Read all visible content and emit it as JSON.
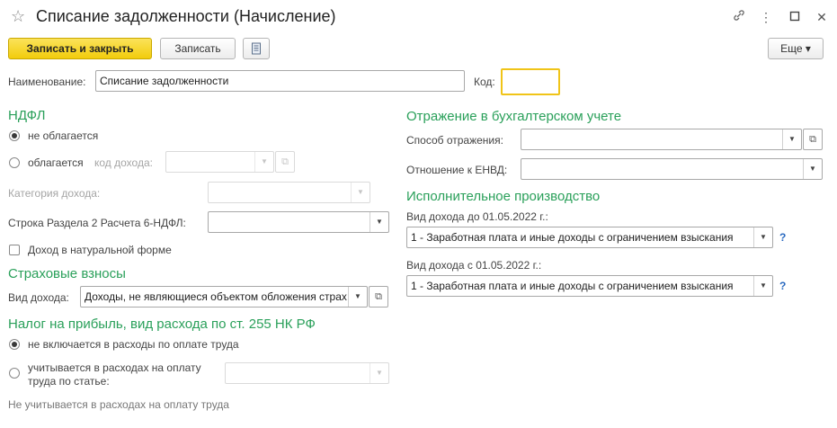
{
  "header": {
    "title": "Списание задолженности (Начисление)",
    "star": "☆",
    "link_icon": "🔗",
    "more_icon": "⋮",
    "maximize_icon": "☐",
    "close_icon": "✕"
  },
  "toolbar": {
    "save_close_label": "Записать и закрыть",
    "save_label": "Записать",
    "more_label": "Еще ▾"
  },
  "name_row": {
    "name_label": "Наименование:",
    "name_value": "Списание задолженности",
    "code_label": "Код:",
    "code_value": ""
  },
  "ndfl": {
    "heading": "НДФЛ",
    "option_not_taxed": "не облагается",
    "option_taxed": "облагается",
    "income_code_label": "код дохода:",
    "income_category_label": "Категория дохода:",
    "section2_label": "Строка Раздела 2 Расчета 6-НДФЛ:",
    "in_kind_label": "Доход в натуральной форме"
  },
  "insurance": {
    "heading": "Страховые взносы",
    "income_type_label": "Вид дохода:",
    "income_type_value": "Доходы, не являющиеся объектом обложения страховыми взносами"
  },
  "profit_tax": {
    "heading": "Налог на прибыль, вид расхода по ст. 255 НК РФ",
    "option_not_included": "не включается в расходы по оплате труда",
    "option_included": "учитывается в расходах на оплату труда по статье:",
    "note": "Не учитывается в расходах на оплату труда"
  },
  "accounting": {
    "heading": "Отражение в бухгалтерском учете",
    "method_label": "Способ отражения:",
    "method_value": "",
    "envd_label": "Отношение к ЕНВД:",
    "envd_value": ""
  },
  "enforcement": {
    "heading": "Исполнительное производство",
    "before_label": "Вид дохода до 01.05.2022 г.:",
    "before_value": "1 - Заработная плата и иные доходы с ограничением взыскания",
    "after_label": "Вид дохода с 01.05.2022 г.:",
    "after_value": "1 - Заработная плата и иные доходы с ограничением взыскания",
    "help": "?"
  },
  "colors": {
    "accent": "#f2cc0c",
    "section": "#2aa05a",
    "help": "#2a6ac0"
  }
}
